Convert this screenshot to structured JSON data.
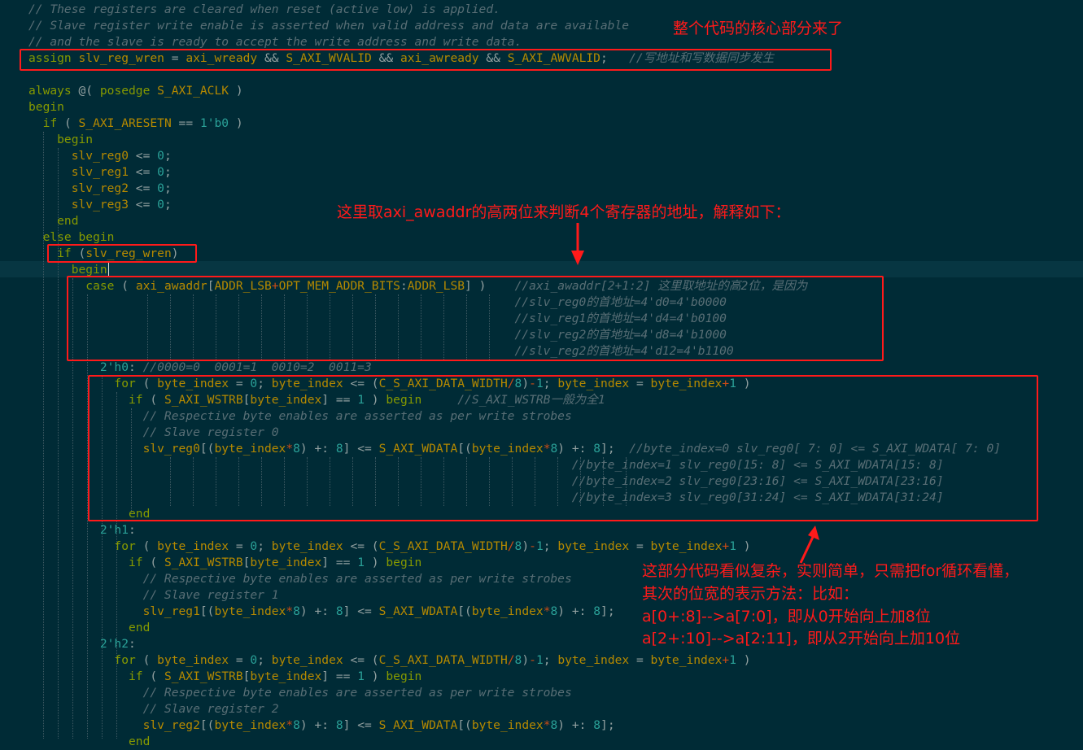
{
  "code_lines": [
    [
      [
        "t-cm",
        "// These registers are cleared when reset (active low) is applied."
      ]
    ],
    [
      [
        "t-cm",
        "// Slave register write enable is asserted when valid address and data are available"
      ]
    ],
    [
      [
        "t-cm",
        "// and the slave is ready to accept the write address and write data."
      ]
    ],
    [
      [
        "t-kw",
        "assign "
      ],
      [
        "t-id",
        "slv_reg_wren"
      ],
      [
        "t-pl",
        " = "
      ],
      [
        "t-id",
        "axi_wready"
      ],
      [
        "t-pl",
        " && "
      ],
      [
        "t-id",
        "S_AXI_WVALID"
      ],
      [
        "t-pl",
        " && "
      ],
      [
        "t-id",
        "axi_awready"
      ],
      [
        "t-pl",
        " && "
      ],
      [
        "t-id",
        "S_AXI_AWVALID"
      ],
      [
        "t-pl",
        ";   "
      ],
      [
        "t-cm",
        "//写地址和写数据同步发生"
      ]
    ],
    [],
    [
      [
        "t-kw",
        "always "
      ],
      [
        "t-pl",
        "@( "
      ],
      [
        "t-kw",
        "posedge "
      ],
      [
        "t-id",
        "S_AXI_ACLK"
      ],
      [
        "t-pl",
        " )"
      ]
    ],
    [
      [
        "t-kw",
        "begin"
      ]
    ],
    [
      [
        "t-kw",
        "  if "
      ],
      [
        "t-pl",
        "( "
      ],
      [
        "t-id",
        "S_AXI_ARESETN"
      ],
      [
        "t-pl",
        " == "
      ],
      [
        "t-num",
        "1'b0"
      ],
      [
        "t-pl",
        " )"
      ]
    ],
    [
      [
        "t-kw",
        "    begin"
      ]
    ],
    [
      [
        "t-id",
        "      slv_reg0"
      ],
      [
        "t-pl",
        " <= "
      ],
      [
        "t-num",
        "0"
      ],
      [
        "t-pl",
        ";"
      ]
    ],
    [
      [
        "t-id",
        "      slv_reg1"
      ],
      [
        "t-pl",
        " <= "
      ],
      [
        "t-num",
        "0"
      ],
      [
        "t-pl",
        ";"
      ]
    ],
    [
      [
        "t-id",
        "      slv_reg2"
      ],
      [
        "t-pl",
        " <= "
      ],
      [
        "t-num",
        "0"
      ],
      [
        "t-pl",
        ";"
      ]
    ],
    [
      [
        "t-id",
        "      slv_reg3"
      ],
      [
        "t-pl",
        " <= "
      ],
      [
        "t-num",
        "0"
      ],
      [
        "t-pl",
        ";"
      ]
    ],
    [
      [
        "t-kw",
        "    end"
      ]
    ],
    [
      [
        "t-kw",
        "  else begin"
      ]
    ],
    [
      [
        "t-kw",
        "    if "
      ],
      [
        "t-pl",
        "("
      ],
      [
        "t-id",
        "slv_reg_wren"
      ],
      [
        "t-pl",
        ")"
      ]
    ],
    [
      [
        "t-kw",
        "      begin"
      ]
    ],
    [
      [
        "t-kw",
        "        case "
      ],
      [
        "t-pl",
        "( "
      ],
      [
        "t-id",
        "axi_awaddr"
      ],
      [
        "t-pl",
        "["
      ],
      [
        "t-id",
        "ADDR_LSB"
      ],
      [
        "t-op",
        "+"
      ],
      [
        "t-id",
        "OPT_MEM_ADDR_BITS"
      ],
      [
        "t-pl",
        ":"
      ],
      [
        "t-id",
        "ADDR_LSB"
      ],
      [
        "t-pl",
        "] )    "
      ],
      [
        "t-cm",
        "//axi_awaddr[2+1:2] 这里取地址的高2位，是因为"
      ]
    ],
    [
      [
        "t-pl",
        "                                                                    "
      ],
      [
        "t-cm",
        "//slv_reg0的首地址=4'd0=4'b0000"
      ]
    ],
    [
      [
        "t-pl",
        "                                                                    "
      ],
      [
        "t-cm",
        "//slv_reg1的首地址=4'd4=4'b0100"
      ]
    ],
    [
      [
        "t-pl",
        "                                                                    "
      ],
      [
        "t-cm",
        "//slv_reg2的首地址=4'd8=4'b1000"
      ]
    ],
    [
      [
        "t-pl",
        "                                                                    "
      ],
      [
        "t-cm",
        "//slv_reg2的首地址=4'd12=4'b1100"
      ]
    ],
    [
      [
        "t-num",
        "          2'h0"
      ],
      [
        "t-pl",
        ": "
      ],
      [
        "t-cm",
        "//0000=0  0001=1  0010=2  0011=3"
      ]
    ],
    [
      [
        "t-kw",
        "            for "
      ],
      [
        "t-pl",
        "( "
      ],
      [
        "t-id",
        "byte_index"
      ],
      [
        "t-pl",
        " = "
      ],
      [
        "t-num",
        "0"
      ],
      [
        "t-pl",
        "; "
      ],
      [
        "t-id",
        "byte_index"
      ],
      [
        "t-pl",
        " <= ("
      ],
      [
        "t-id",
        "C_S_AXI_DATA_WIDTH"
      ],
      [
        "t-op",
        "/"
      ],
      [
        "t-num",
        "8"
      ],
      [
        "t-pl",
        ")"
      ],
      [
        "t-op",
        "-"
      ],
      [
        "t-num",
        "1"
      ],
      [
        "t-pl",
        "; "
      ],
      [
        "t-id",
        "byte_index"
      ],
      [
        "t-pl",
        " = "
      ],
      [
        "t-id",
        "byte_index"
      ],
      [
        "t-op",
        "+"
      ],
      [
        "t-num",
        "1"
      ],
      [
        "t-pl",
        " )"
      ]
    ],
    [
      [
        "t-kw",
        "              if "
      ],
      [
        "t-pl",
        "( "
      ],
      [
        "t-id",
        "S_AXI_WSTRB"
      ],
      [
        "t-pl",
        "["
      ],
      [
        "t-id",
        "byte_index"
      ],
      [
        "t-pl",
        "] == "
      ],
      [
        "t-num",
        "1"
      ],
      [
        "t-pl",
        " ) "
      ],
      [
        "t-kw",
        "begin"
      ],
      [
        "t-pl",
        "     "
      ],
      [
        "t-cm",
        "//S_AXI_WSTRB一般为全1"
      ]
    ],
    [
      [
        "t-cm",
        "                // Respective byte enables are asserted as per write strobes"
      ]
    ],
    [
      [
        "t-cm",
        "                // Slave register 0"
      ]
    ],
    [
      [
        "t-id",
        "                slv_reg0"
      ],
      [
        "t-pl",
        "[("
      ],
      [
        "t-id",
        "byte_index"
      ],
      [
        "t-op",
        "*"
      ],
      [
        "t-num",
        "8"
      ],
      [
        "t-pl",
        ") +: "
      ],
      [
        "t-num",
        "8"
      ],
      [
        "t-pl",
        "] <= "
      ],
      [
        "t-id",
        "S_AXI_WDATA"
      ],
      [
        "t-pl",
        "[("
      ],
      [
        "t-id",
        "byte_index"
      ],
      [
        "t-op",
        "*"
      ],
      [
        "t-num",
        "8"
      ],
      [
        "t-pl",
        ") +: "
      ],
      [
        "t-num",
        "8"
      ],
      [
        "t-pl",
        "];  "
      ],
      [
        "t-cm",
        "//byte_index=0 slv_reg0[ 7: 0] <= S_AXI_WDATA[ 7: 0]"
      ]
    ],
    [
      [
        "t-pl",
        "                                                                            "
      ],
      [
        "t-cm",
        "//byte_index=1 slv_reg0[15: 8] <= S_AXI_WDATA[15: 8]"
      ]
    ],
    [
      [
        "t-pl",
        "                                                                            "
      ],
      [
        "t-cm",
        "//byte_index=2 slv_reg0[23:16] <= S_AXI_WDATA[23:16]"
      ]
    ],
    [
      [
        "t-pl",
        "                                                                            "
      ],
      [
        "t-cm",
        "//byte_index=3 slv_reg0[31:24] <= S_AXI_WDATA[31:24]"
      ]
    ],
    [
      [
        "t-kw",
        "              end"
      ]
    ],
    [
      [
        "t-num",
        "          2'h1"
      ],
      [
        "t-pl",
        ":"
      ]
    ],
    [
      [
        "t-kw",
        "            for "
      ],
      [
        "t-pl",
        "( "
      ],
      [
        "t-id",
        "byte_index"
      ],
      [
        "t-pl",
        " = "
      ],
      [
        "t-num",
        "0"
      ],
      [
        "t-pl",
        "; "
      ],
      [
        "t-id",
        "byte_index"
      ],
      [
        "t-pl",
        " <= ("
      ],
      [
        "t-id",
        "C_S_AXI_DATA_WIDTH"
      ],
      [
        "t-op",
        "/"
      ],
      [
        "t-num",
        "8"
      ],
      [
        "t-pl",
        ")"
      ],
      [
        "t-op",
        "-"
      ],
      [
        "t-num",
        "1"
      ],
      [
        "t-pl",
        "; "
      ],
      [
        "t-id",
        "byte_index"
      ],
      [
        "t-pl",
        " = "
      ],
      [
        "t-id",
        "byte_index"
      ],
      [
        "t-op",
        "+"
      ],
      [
        "t-num",
        "1"
      ],
      [
        "t-pl",
        " )"
      ]
    ],
    [
      [
        "t-kw",
        "              if "
      ],
      [
        "t-pl",
        "( "
      ],
      [
        "t-id",
        "S_AXI_WSTRB"
      ],
      [
        "t-pl",
        "["
      ],
      [
        "t-id",
        "byte_index"
      ],
      [
        "t-pl",
        "] == "
      ],
      [
        "t-num",
        "1"
      ],
      [
        "t-pl",
        " ) "
      ],
      [
        "t-kw",
        "begin"
      ]
    ],
    [
      [
        "t-cm",
        "                // Respective byte enables are asserted as per write strobes"
      ]
    ],
    [
      [
        "t-cm",
        "                // Slave register 1"
      ]
    ],
    [
      [
        "t-id",
        "                slv_reg1"
      ],
      [
        "t-pl",
        "[("
      ],
      [
        "t-id",
        "byte_index"
      ],
      [
        "t-op",
        "*"
      ],
      [
        "t-num",
        "8"
      ],
      [
        "t-pl",
        ") +: "
      ],
      [
        "t-num",
        "8"
      ],
      [
        "t-pl",
        "] <= "
      ],
      [
        "t-id",
        "S_AXI_WDATA"
      ],
      [
        "t-pl",
        "[("
      ],
      [
        "t-id",
        "byte_index"
      ],
      [
        "t-op",
        "*"
      ],
      [
        "t-num",
        "8"
      ],
      [
        "t-pl",
        ") +: "
      ],
      [
        "t-num",
        "8"
      ],
      [
        "t-pl",
        "];"
      ]
    ],
    [
      [
        "t-kw",
        "              end"
      ]
    ],
    [
      [
        "t-num",
        "          2'h2"
      ],
      [
        "t-pl",
        ":"
      ]
    ],
    [
      [
        "t-kw",
        "            for "
      ],
      [
        "t-pl",
        "( "
      ],
      [
        "t-id",
        "byte_index"
      ],
      [
        "t-pl",
        " = "
      ],
      [
        "t-num",
        "0"
      ],
      [
        "t-pl",
        "; "
      ],
      [
        "t-id",
        "byte_index"
      ],
      [
        "t-pl",
        " <= ("
      ],
      [
        "t-id",
        "C_S_AXI_DATA_WIDTH"
      ],
      [
        "t-op",
        "/"
      ],
      [
        "t-num",
        "8"
      ],
      [
        "t-pl",
        ")"
      ],
      [
        "t-op",
        "-"
      ],
      [
        "t-num",
        "1"
      ],
      [
        "t-pl",
        "; "
      ],
      [
        "t-id",
        "byte_index"
      ],
      [
        "t-pl",
        " = "
      ],
      [
        "t-id",
        "byte_index"
      ],
      [
        "t-op",
        "+"
      ],
      [
        "t-num",
        "1"
      ],
      [
        "t-pl",
        " )"
      ]
    ],
    [
      [
        "t-kw",
        "              if "
      ],
      [
        "t-pl",
        "( "
      ],
      [
        "t-id",
        "S_AXI_WSTRB"
      ],
      [
        "t-pl",
        "["
      ],
      [
        "t-id",
        "byte_index"
      ],
      [
        "t-pl",
        "] == "
      ],
      [
        "t-num",
        "1"
      ],
      [
        "t-pl",
        " ) "
      ],
      [
        "t-kw",
        "begin"
      ]
    ],
    [
      [
        "t-cm",
        "                // Respective byte enables are asserted as per write strobes"
      ]
    ],
    [
      [
        "t-cm",
        "                // Slave register 2"
      ]
    ],
    [
      [
        "t-id",
        "                slv_reg2"
      ],
      [
        "t-pl",
        "[("
      ],
      [
        "t-id",
        "byte_index"
      ],
      [
        "t-op",
        "*"
      ],
      [
        "t-num",
        "8"
      ],
      [
        "t-pl",
        ") +: "
      ],
      [
        "t-num",
        "8"
      ],
      [
        "t-pl",
        "] <= "
      ],
      [
        "t-id",
        "S_AXI_WDATA"
      ],
      [
        "t-pl",
        "[("
      ],
      [
        "t-id",
        "byte_index"
      ],
      [
        "t-op",
        "*"
      ],
      [
        "t-num",
        "8"
      ],
      [
        "t-pl",
        ") +: "
      ],
      [
        "t-num",
        "8"
      ],
      [
        "t-pl",
        "];"
      ]
    ],
    [
      [
        "t-kw",
        "              end"
      ]
    ]
  ],
  "annotations": {
    "core_note": "整个代码的核心部分来了",
    "addr_note": "这里取axi_awaddr的高两位来判断4个寄存器的地址，解释如下：",
    "for_note_1": "这部分代码看似复杂，实则简单，只需把for循环看懂，",
    "for_note_2": "其次的位宽的表示方法：比如：",
    "for_note_3": "a[0+:8]-->a[7:0]，即从0开始向上加8位",
    "for_note_4": "a[2+:10]-->a[2:11]，即从2开始向上加10位"
  },
  "colors": {
    "background": "#002b36",
    "current_line": "#073642",
    "keyword": "#859900",
    "identifier": "#b58900",
    "number": "#2aa198",
    "operator": "#cb4b16",
    "comment": "#586e75",
    "annotation": "#ff1a1a"
  }
}
